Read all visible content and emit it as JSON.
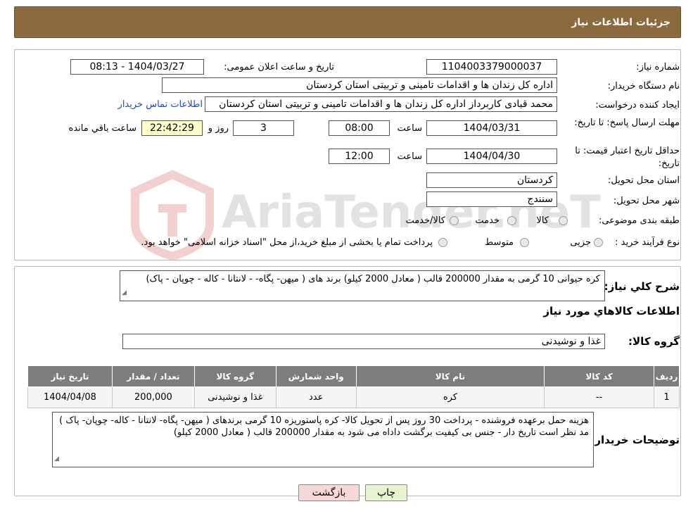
{
  "header": {
    "title": "جزئیات اطلاعات نیاز"
  },
  "form": {
    "need_number_label": "شماره نیاز:",
    "need_number": "1104003379000037",
    "announce_label": "تاریخ و ساعت اعلان عمومی:",
    "announce_value": "1404/03/27 - 08:13",
    "buyer_org_label": "نام دستگاه خریدار:",
    "buyer_org": "اداره کل زندان ها و اقدامات تامینی و تربیتی استان کردستان",
    "creator_label": "ایجاد کننده درخواست:",
    "creator": "محمد  قبادی کاربرداز اداره کل زندان ها و اقدامات تامینی و تربیتی استان کردستان",
    "contact_link": "اطلاعات تماس خریدار",
    "deadline_label": "مهلت ارسال پاسخ: تا تاریخ:",
    "deadline_date": "1404/03/31",
    "time_label": "ساعت",
    "deadline_time": "08:00",
    "days_value": "3",
    "days_label": "روز و",
    "remaining_time": "22:42:29",
    "remaining_label": "ساعت باقي مانده",
    "validity_label": "حداقل تاریخ اعتبار قیمت: تا تاریخ:",
    "validity_date": "1404/04/30",
    "validity_time": "12:00",
    "province_label": "استان محل تحویل:",
    "province": "کردستان",
    "city_label": "شهر محل تحویل:",
    "city": "سنندج",
    "category_label": "طبقه بندی موضوعی:",
    "category_options": [
      "کالا",
      "خدمت",
      "کالا/خدمت"
    ],
    "process_label": "نوع فرآیند خرید :",
    "process_options": [
      "جزیی",
      "متوسط"
    ],
    "process_note": "پرداخت تمام یا بخشی از مبلغ خرید،از محل \"اسناد خزانه اسلامی\" خواهد بود."
  },
  "summary": {
    "label": "شرح کلي نياز:",
    "text": "کره  حیوانی 10 گرمی  به  مقدار 200000 قالب  ( معادل  2000 کیلو)  برند های (  میهن- پگاه-  - لانتانا - کاله - چوپان - پاک)",
    "items_title": "اطلاعات کالاهاي مورد نياز",
    "group_label": "گروه کالا:",
    "group_value": "غذا و نوشیدنی"
  },
  "table": {
    "headers": [
      "ردیف",
      "کد کالا",
      "نام کالا",
      "واحد شمارش",
      "گروه کالا",
      "تعداد / مقدار",
      "تاریخ نیاز"
    ],
    "row": [
      "1",
      "--",
      "کره",
      "عدد",
      "غذا و نوشیدنی",
      "200,000",
      "1404/04/08"
    ]
  },
  "notes": {
    "label": "توضیحات خریدار:",
    "text": "هزینه حمل برعهده فروشنده - پرداخت 30 روز پس از تحویل کالا-  کره  پاستوریزه 10 گرمی برندهای ( میهن- پگاه- لانتانا - کاله- چوپان- پاک  )  مد نظر است  تاریخ دار  - جنس بی کیفیت برگشت داداه می شود به  مقدار 200000 قالب  ( معادل  2000 کیلو)"
  },
  "buttons": {
    "print": "چاپ",
    "back": "بازگشت"
  },
  "watermark": {
    "text": "AriaTender.neT"
  },
  "colors": {
    "header": "#8b6a3e",
    "link": "#1d48c9",
    "back_button": "#f8d7d7",
    "print_button": "#e6f5d0"
  }
}
